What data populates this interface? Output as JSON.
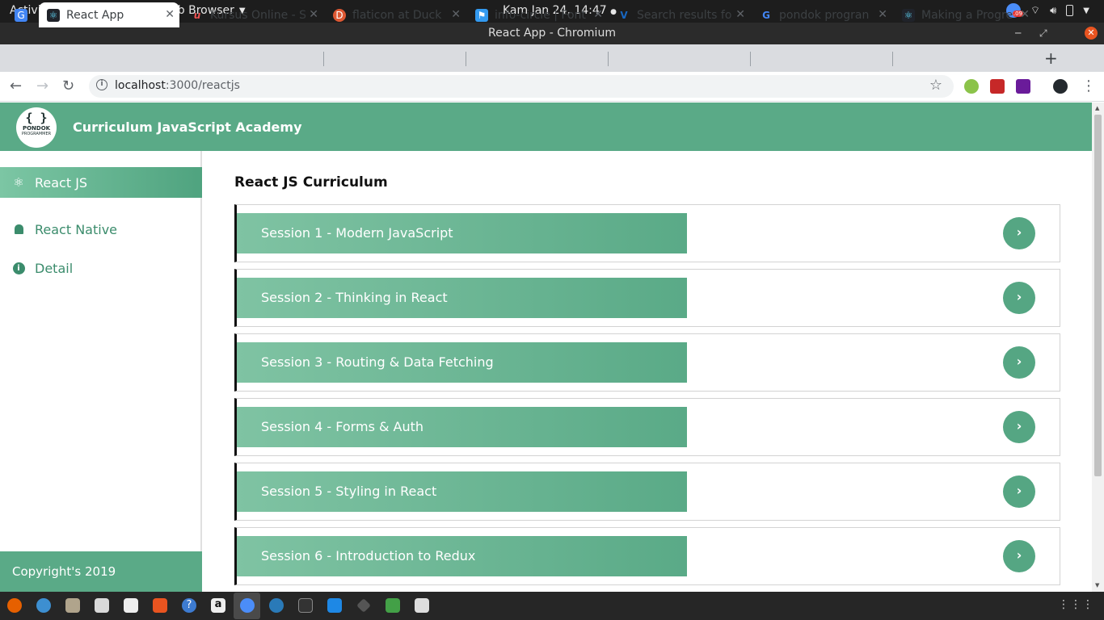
{
  "system": {
    "activities": "Activities",
    "app_menu": "Chromium Web Browser",
    "clock": "Kam Jan 24, 14:47",
    "notification_badge": ".09"
  },
  "window": {
    "title": "React App - Chromium"
  },
  "tabs": [
    {
      "title": "",
      "icon": "google-translate-icon",
      "color": "#4285f4"
    },
    {
      "title": "React App",
      "icon": "react-icon",
      "color": "#61dafb",
      "active": true
    },
    {
      "title": "Kursus Online - S",
      "icon": "udemy-icon",
      "color": "#ec5252"
    },
    {
      "title": "flaticon at Duck",
      "icon": "duckduckgo-icon",
      "color": "#de5833"
    },
    {
      "title": "info-circle | Font",
      "icon": "fontawesome-flag-icon",
      "color": "#339af0"
    },
    {
      "title": "Search results fo",
      "icon": "vuetify-icon",
      "color": "#1867c0"
    },
    {
      "title": "pondok progran",
      "icon": "google-icon",
      "color": "#4285f4"
    },
    {
      "title": "Making a Progre",
      "icon": "react-icon",
      "color": "#61dafb"
    }
  ],
  "toolbar": {
    "url_host": "localhost",
    "url_path": ":3000/reactjs"
  },
  "app": {
    "logo": {
      "braces": "{ }",
      "name": "PONDOK",
      "sub": "PROGRAMMER"
    },
    "title": "Curriculum JavaScript Academy",
    "accent": "#5aaa87"
  },
  "sidebar": {
    "items": [
      {
        "label": "React JS",
        "icon": "react-atom-icon",
        "active": true
      },
      {
        "label": "React Native",
        "icon": "android-icon"
      },
      {
        "label": "Detail",
        "icon": "info-circle-icon"
      }
    ],
    "footer": "Copyright's 2019"
  },
  "main": {
    "heading": "React JS Curriculum",
    "sessions": [
      "Session 1 - Modern JavaScript",
      "Session 2 - Thinking in React",
      "Session 3 - Routing & Data Fetching",
      "Session 4 - Forms & Auth",
      "Session 5 - Styling in React",
      "Session 6 - Introduction to Redux"
    ]
  }
}
